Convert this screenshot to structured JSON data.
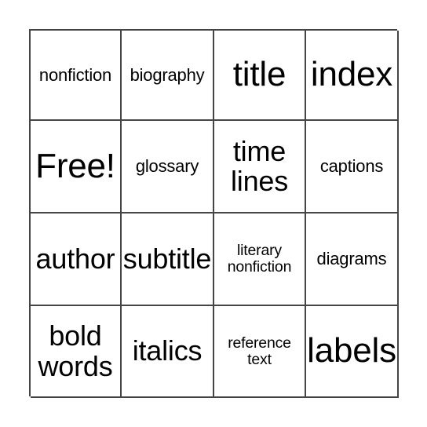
{
  "card": {
    "type": "bingo-card",
    "rows": 4,
    "columns": 4,
    "border_color": "#454545",
    "background_color": "#ffffff",
    "text_color": "#000000",
    "cells": [
      {
        "id": "r1c1",
        "text": "nonfiction",
        "size": "md",
        "free_space": false
      },
      {
        "id": "r1c2",
        "text": "biography",
        "size": "md",
        "free_space": false
      },
      {
        "id": "r1c3",
        "text": "title",
        "size": "xl",
        "free_space": false
      },
      {
        "id": "r1c4",
        "text": "index",
        "size": "xl",
        "free_space": false
      },
      {
        "id": "r2c1",
        "text": "Free!",
        "size": "xl",
        "free_space": true
      },
      {
        "id": "r2c2",
        "text": "glossary",
        "size": "md",
        "free_space": false
      },
      {
        "id": "r2c3",
        "text": "time\nlines",
        "size": "lg",
        "free_space": false
      },
      {
        "id": "r2c4",
        "text": "captions",
        "size": "md",
        "free_space": false
      },
      {
        "id": "r3c1",
        "text": "author",
        "size": "lg",
        "free_space": false
      },
      {
        "id": "r3c2",
        "text": "subtitle",
        "size": "lg",
        "free_space": false
      },
      {
        "id": "r3c3",
        "text": "literary\nnonfiction",
        "size": "sm",
        "free_space": false
      },
      {
        "id": "r3c4",
        "text": "diagrams",
        "size": "md",
        "free_space": false
      },
      {
        "id": "r4c1",
        "text": "bold\nwords",
        "size": "lg",
        "free_space": false
      },
      {
        "id": "r4c2",
        "text": "italics",
        "size": "lg",
        "free_space": false
      },
      {
        "id": "r4c3",
        "text": "reference\ntext",
        "size": "sm",
        "free_space": false
      },
      {
        "id": "r4c4",
        "text": "labels",
        "size": "xl",
        "free_space": false
      }
    ]
  }
}
